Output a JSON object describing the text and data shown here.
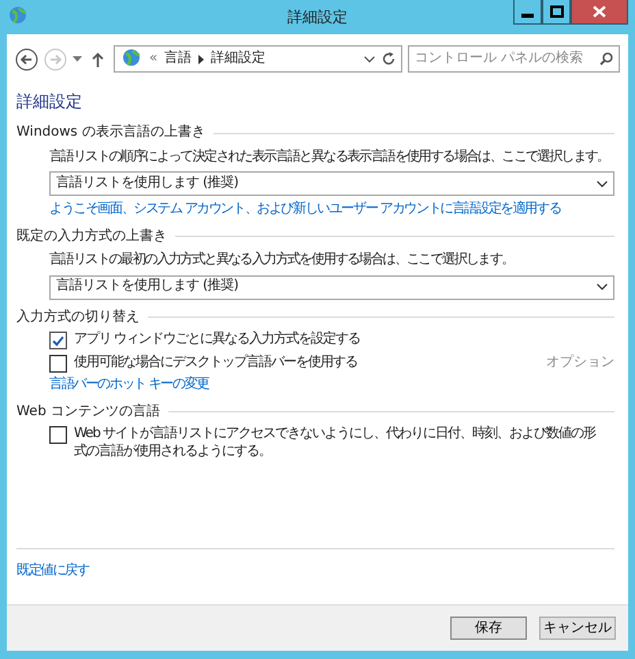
{
  "window": {
    "title": "詳細設定"
  },
  "nav": {
    "back_disabled": false,
    "forward_disabled": true,
    "overflow": "«",
    "breadcrumb": [
      "言語",
      "詳細設定"
    ],
    "search": {
      "placeholder": "コントロール パネルの検索"
    }
  },
  "heading": "詳細設定",
  "sections": [
    {
      "kind": "dropdown",
      "title": "Windows の表示言語の上書き",
      "description": "言語リストの順序によって決定された表示言語と異なる表示言語を使用する場合は、ここで選択します。",
      "value": "言語リストを使用します (推奨)",
      "link": "ようこそ画面、システム アカウント、および新しいユーザー アカウントに言語設定を適用する"
    },
    {
      "kind": "dropdown",
      "title": "既定の入力方式の上書き",
      "description": "言語リストの最初の入力方式と異なる入力方式を使用する場合は、ここで選択します。",
      "value": "言語リストを使用します (推奨)"
    },
    {
      "kind": "checkboxes",
      "title": "入力方式の切り替え",
      "items": [
        {
          "label": "アプリ ウィンドウごとに異なる入力方式を設定する",
          "checked": true
        },
        {
          "label": "使用可能な場合にデスクトップ言語バーを使用する",
          "checked": false,
          "option": "オプション"
        }
      ],
      "link": "言語バーのホット キーの変更"
    },
    {
      "kind": "checkboxes",
      "title": "Web コンテンツの言語",
      "items": [
        {
          "label": "Web サイトが言語リストにアクセスできないようにし、代わりに日付、時刻、および数値の形式の言語が使用されるようにする。",
          "checked": false
        }
      ]
    }
  ],
  "reset_link": "既定値に戻す",
  "buttons": [
    {
      "label": "保存",
      "primary": true
    },
    {
      "label": "キャンセル",
      "primary": false
    }
  ]
}
